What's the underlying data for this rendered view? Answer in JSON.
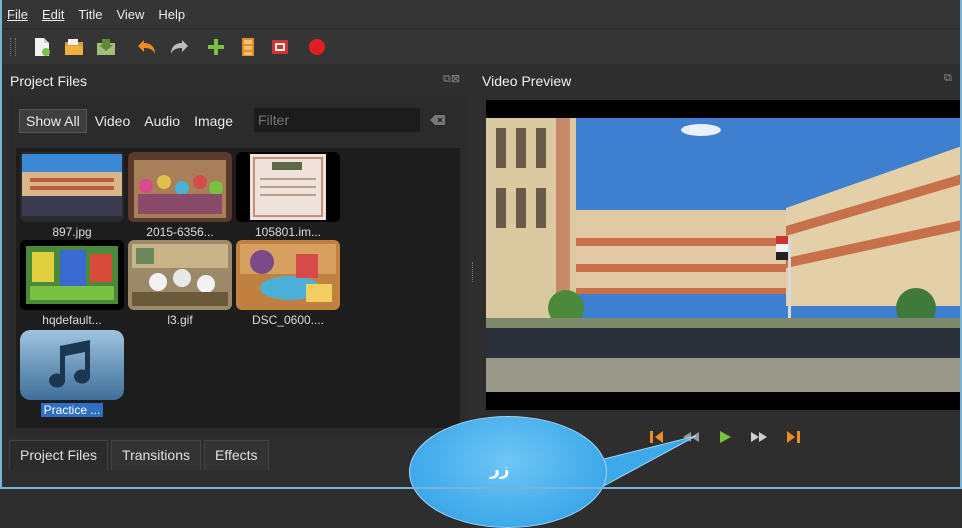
{
  "menu": {
    "file": "File",
    "edit": "Edit",
    "title": "Title",
    "view": "View",
    "help": "Help"
  },
  "toolbar": {
    "buttons": [
      "new-project-icon",
      "open-project-icon",
      "save-project-icon",
      "undo-icon",
      "redo-icon",
      "import-files-icon",
      "profile-icon",
      "fullscreen-icon",
      "export-video-icon"
    ]
  },
  "project_panel": {
    "title": "Project Files",
    "filters": {
      "show_all": "Show All",
      "video": "Video",
      "audio": "Audio",
      "image": "Image"
    },
    "filter_placeholder": "Filter",
    "files": [
      {
        "name": "897.jpg"
      },
      {
        "name": "2015-6356..."
      },
      {
        "name": "105801.im..."
      },
      {
        "name": "hqdefault..."
      },
      {
        "name": "l3.gif"
      },
      {
        "name": "DSC_0600...."
      },
      {
        "name": "Practice ..."
      }
    ]
  },
  "tabs": {
    "project_files": "Project Files",
    "transitions": "Transitions",
    "effects": "Effects"
  },
  "preview_panel": {
    "title": "Video Preview"
  },
  "callout": {
    "text": "زر"
  },
  "colors": {
    "accent_orange": "#f08a24",
    "play_green": "#7ac143",
    "callout_blue": "#3ea9ea",
    "selection_blue": "#2f6fc0"
  }
}
